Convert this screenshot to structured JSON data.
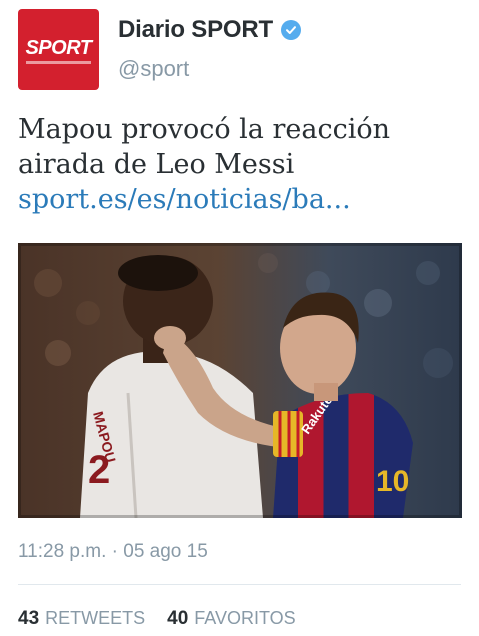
{
  "account": {
    "display_name": "Diario SPORT",
    "handle": "@sport",
    "avatar_text": "SPORT",
    "verified": true
  },
  "tweet": {
    "text": "Mapou provocó la reacción airada de Leo Messi ",
    "link_text": "sport.es/es/noticias/ba...",
    "media": {
      "jersey_back_text": "MAPOU",
      "jersey_number": "2",
      "shirt_sponsor": "Rakuten",
      "shirt_number": "10"
    }
  },
  "meta": {
    "timestamp": "11:28 p.m. · 05 ago 15"
  },
  "stats": {
    "retweets_count": "43",
    "retweets_label": "RETWEETS",
    "favorites_count": "40",
    "favorites_label": "FAVORITOS"
  },
  "colors": {
    "brand_red": "#d3202e",
    "verified_blue": "#55acee",
    "link_blue": "#2b7bb9",
    "text_dark": "#292f33",
    "text_muted": "#8899a6"
  }
}
